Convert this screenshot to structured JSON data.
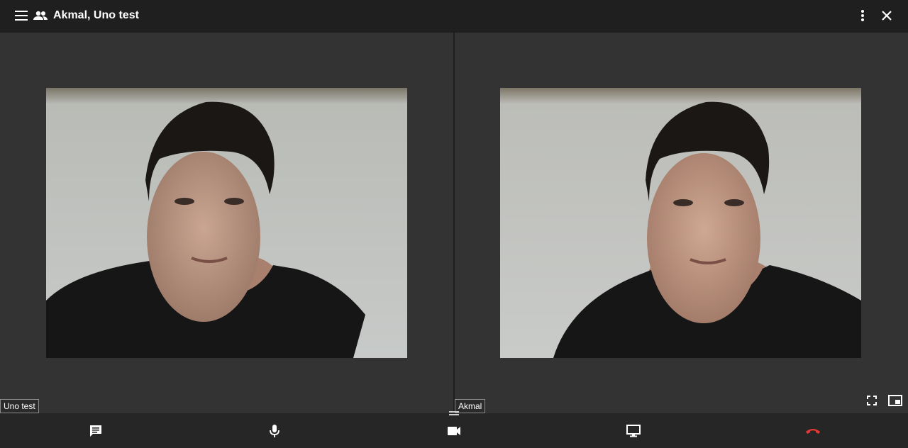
{
  "header": {
    "title": "Akmal, Uno test",
    "menu_icon": "menu-icon",
    "people_icon": "people-icon",
    "more_icon": "more-vert-icon",
    "close_icon": "close-icon"
  },
  "participants": [
    {
      "name": "Uno test"
    },
    {
      "name": "Akmal"
    }
  ],
  "pane_controls": {
    "fullscreen_icon": "fullscreen-icon",
    "pip_icon": "picture-in-picture-icon"
  },
  "controls": {
    "chat_icon": "chat-icon",
    "mic_icon": "mic-icon",
    "camera_icon": "videocam-icon",
    "screen_share_icon": "screen-share-icon",
    "hangup_icon": "call-end-icon"
  },
  "colors": {
    "topbar": "#1f1f1f",
    "stage": "#333333",
    "bottombar": "#262626",
    "hangup": "#e53935"
  }
}
